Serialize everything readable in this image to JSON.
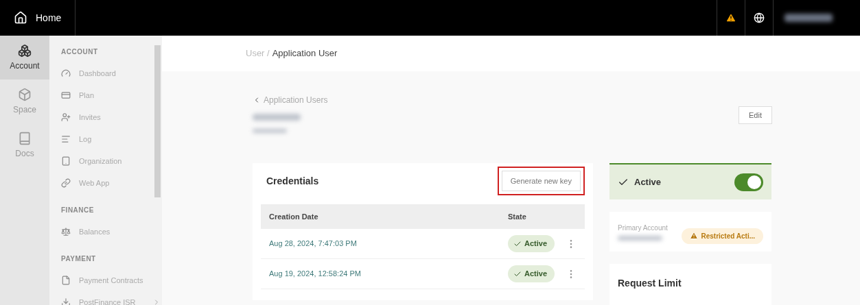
{
  "top_bar": {
    "home_label": "Home"
  },
  "rail": [
    {
      "label": "Account",
      "selected": true
    },
    {
      "label": "Space",
      "selected": false
    },
    {
      "label": "Docs",
      "selected": false
    }
  ],
  "sidebar": [
    {
      "heading": "ACCOUNT",
      "items": [
        {
          "label": "Dashboard",
          "kind": "gauge",
          "expandable": false
        },
        {
          "label": "Plan",
          "kind": "card",
          "expandable": false
        },
        {
          "label": "Invites",
          "kind": "userplus",
          "expandable": false
        },
        {
          "label": "Log",
          "kind": "lines",
          "expandable": false
        },
        {
          "label": "Organization",
          "kind": "tablet",
          "expandable": false
        },
        {
          "label": "Web App",
          "kind": "link",
          "expandable": false
        }
      ]
    },
    {
      "heading": "FINANCE",
      "items": [
        {
          "label": "Balances",
          "kind": "scale",
          "expandable": false
        }
      ]
    },
    {
      "heading": "PAYMENT",
      "items": [
        {
          "label": "Payment Contracts",
          "kind": "file",
          "expandable": false
        },
        {
          "label": "PostFinance ISR",
          "kind": "download",
          "expandable": true
        }
      ]
    }
  ],
  "breadcrumb": {
    "parent": "User",
    "separator": "/",
    "current": "Application User"
  },
  "back_link": "Application Users",
  "edit_button": "Edit",
  "credentials": {
    "title": "Credentials",
    "button": {
      "label": "Generate new key",
      "highlighted": true
    },
    "columns": [
      "Creation Date",
      "State"
    ],
    "rows": [
      {
        "date": "Aug 28, 2024, 7:47:03 PM",
        "state": "Active"
      },
      {
        "date": "Aug 19, 2024, 12:58:24 PM",
        "state": "Active"
      }
    ]
  },
  "status_card": {
    "label": "Active",
    "on": true
  },
  "primary_account": {
    "label": "Primary Account",
    "badge": "Restricted Acti..."
  },
  "request_limit": {
    "title": "Request Limit"
  }
}
